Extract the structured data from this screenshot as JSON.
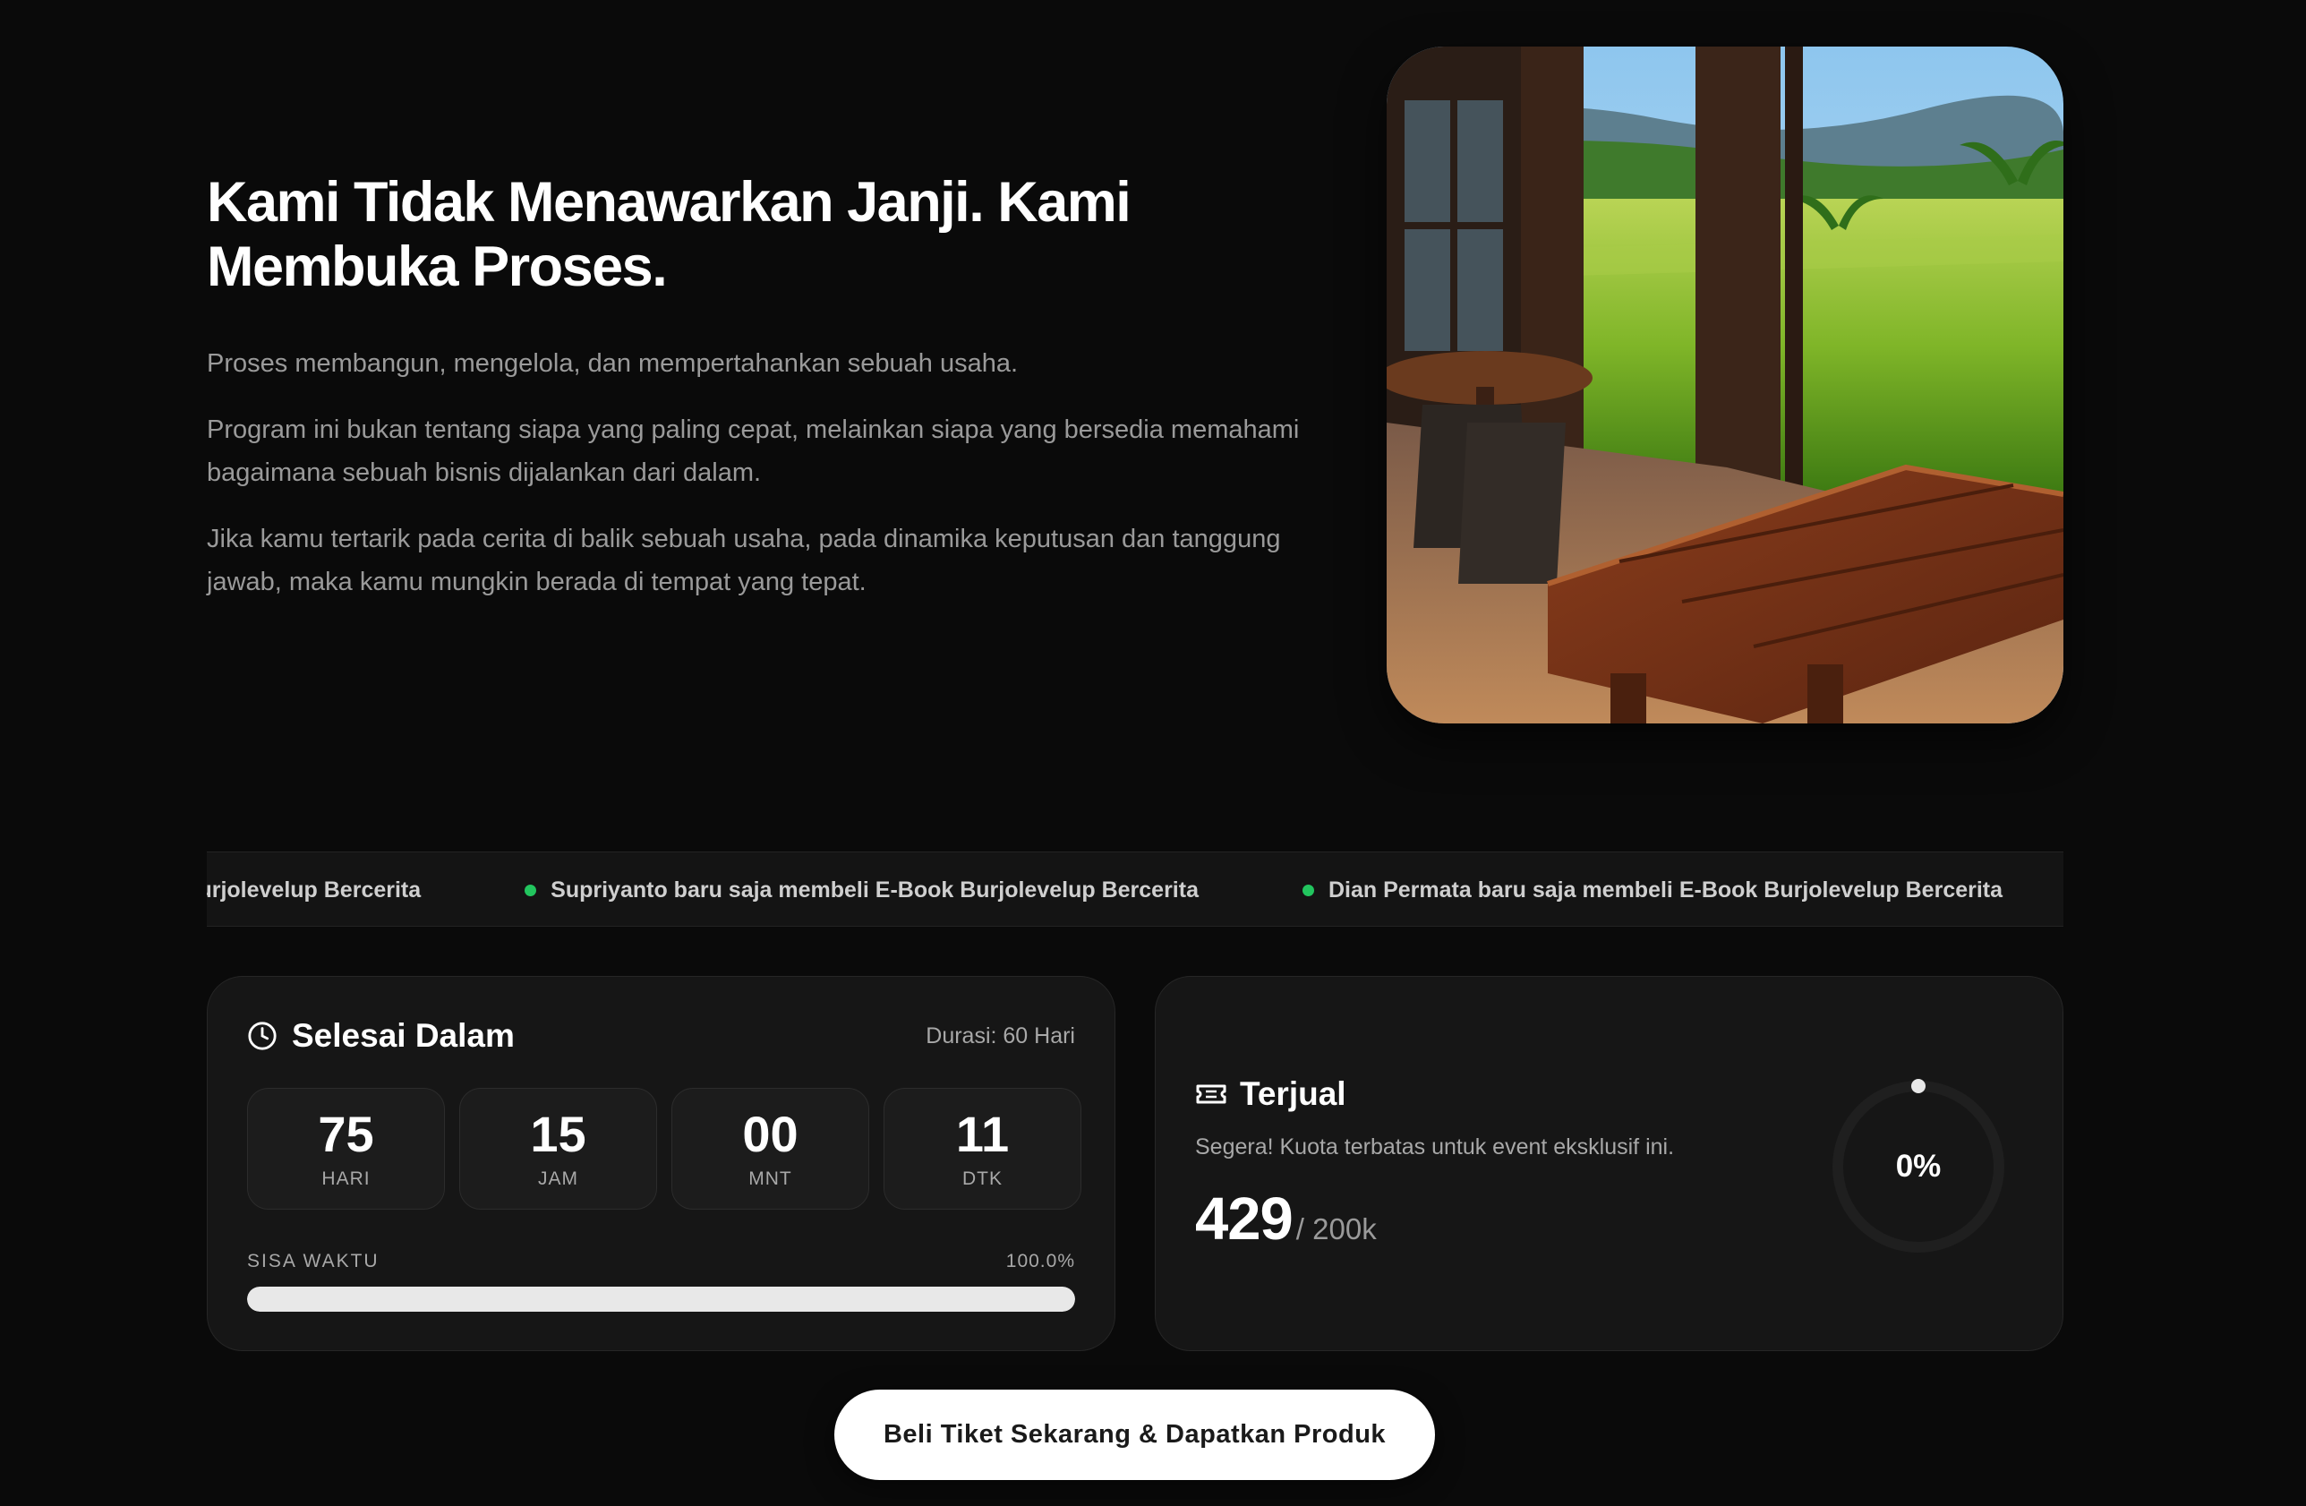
{
  "hero": {
    "title": "Kami Tidak Menawarkan Janji. Kami Membuka Proses.",
    "paragraphs": [
      "Proses membangun, mengelola, dan mempertahankan sebuah usaha.",
      "Program ini bukan tentang siapa yang paling cepat, melainkan siapa yang bersedia memahami bagaimana sebuah bisnis dijalankan dari dalam.",
      "Jika kamu tertarik pada cerita di balik sebuah usaha, pada dinamika keputusan dan tanggung jawab, maka kamu mungkin berada di tempat yang tepat."
    ]
  },
  "ticker": {
    "items": [
      "ook Burjolevelup Bercerita",
      "Supriyanto baru saja membeli E-Book Burjolevelup Bercerita",
      "Dian Permata baru saja membeli E-Book Burjolevelup Bercerita"
    ],
    "dot_color": "#22c55e"
  },
  "countdown": {
    "icon": "clock-icon",
    "title": "Selesai Dalam",
    "duration": "Durasi: 60 Hari",
    "units": [
      {
        "value": "75",
        "label": "HARI"
      },
      {
        "value": "15",
        "label": "JAM"
      },
      {
        "value": "00",
        "label": "MNT"
      },
      {
        "value": "11",
        "label": "DTK"
      }
    ],
    "remaining_label": "SISA WAKTU",
    "remaining_text": "100.0%",
    "remaining_fraction": 1.0
  },
  "sold": {
    "icon": "ticket-icon",
    "title": "Terjual",
    "description": "Segera! Kuota terbatas untuk event eksklusif ini.",
    "count": "429",
    "total": "/ 200k",
    "percent_text": "0%",
    "percent_fraction": 0.0
  },
  "cta": {
    "label": "Beli Tiket Sekarang & Dapatkan Produk"
  }
}
